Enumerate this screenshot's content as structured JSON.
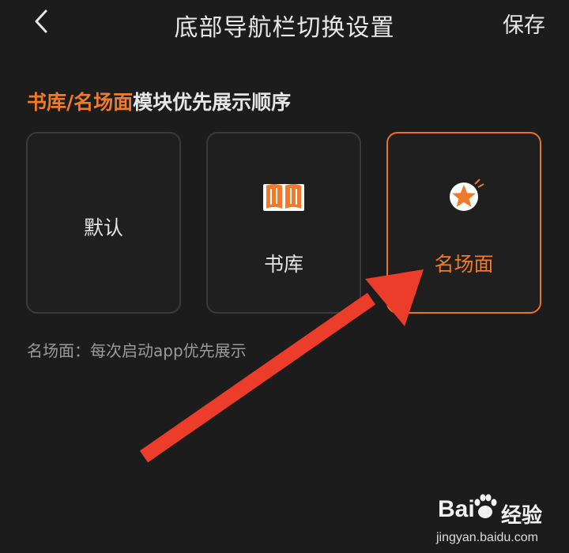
{
  "header": {
    "title": "底部导航栏切换设置",
    "save_label": "保存",
    "back_icon": "chevron-left-icon"
  },
  "section": {
    "title_highlight": "书库/名场面",
    "title_rest": "模块优先展示顺序"
  },
  "options": [
    {
      "label": "默认",
      "icon": null,
      "selected": false
    },
    {
      "label": "书库",
      "icon": "open-book-icon",
      "selected": false
    },
    {
      "label": "名场面",
      "icon": "star-icon",
      "selected": true
    }
  ],
  "hint": "名场面：每次启动app优先展示",
  "watermark": {
    "brand": "Bai",
    "suffix": "经验",
    "url": "jingyan.baidu.com"
  },
  "colors": {
    "background": "#1c1c1c",
    "accent": "#ef7a2a",
    "card_border": "#3a3a3a",
    "annotation_arrow": "#ec3d2b"
  }
}
